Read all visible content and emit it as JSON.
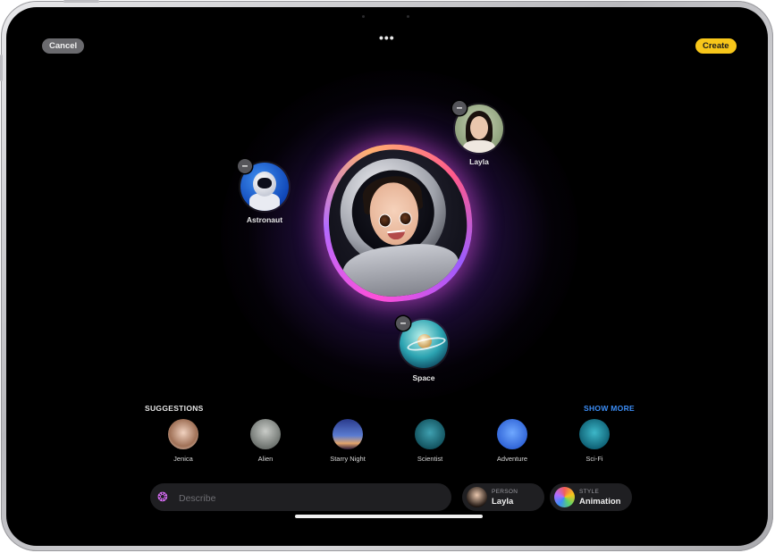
{
  "top_bar": {
    "cancel_label": "Cancel",
    "create_label": "Create",
    "more_label": "•••"
  },
  "canvas": {
    "main_image_name": "astronaut-portrait"
  },
  "concept_bubbles": [
    {
      "label": "Astronaut",
      "icon": "astronaut-icon",
      "remove_label": "–"
    },
    {
      "label": "Layla",
      "icon": "person-photo",
      "remove_label": "–"
    },
    {
      "label": "Space",
      "icon": "planet-icon",
      "remove_label": "–"
    }
  ],
  "suggestions": {
    "title": "SUGGESTIONS",
    "show_more": "SHOW MORE",
    "items": [
      {
        "label": "Jenica"
      },
      {
        "label": "Alien"
      },
      {
        "label": "Starry Night"
      },
      {
        "label": "Scientist"
      },
      {
        "label": "Adventure"
      },
      {
        "label": "Sci-Fi"
      }
    ]
  },
  "bottom_bar": {
    "describe_placeholder": "Describe",
    "person_chip": {
      "caption": "PERSON",
      "value": "Layla"
    },
    "style_chip": {
      "caption": "STYLE",
      "value": "Animation"
    }
  },
  "colors": {
    "accent_create": "#f7c61a",
    "show_more_blue": "#3c8ef7",
    "background": "#000000"
  }
}
